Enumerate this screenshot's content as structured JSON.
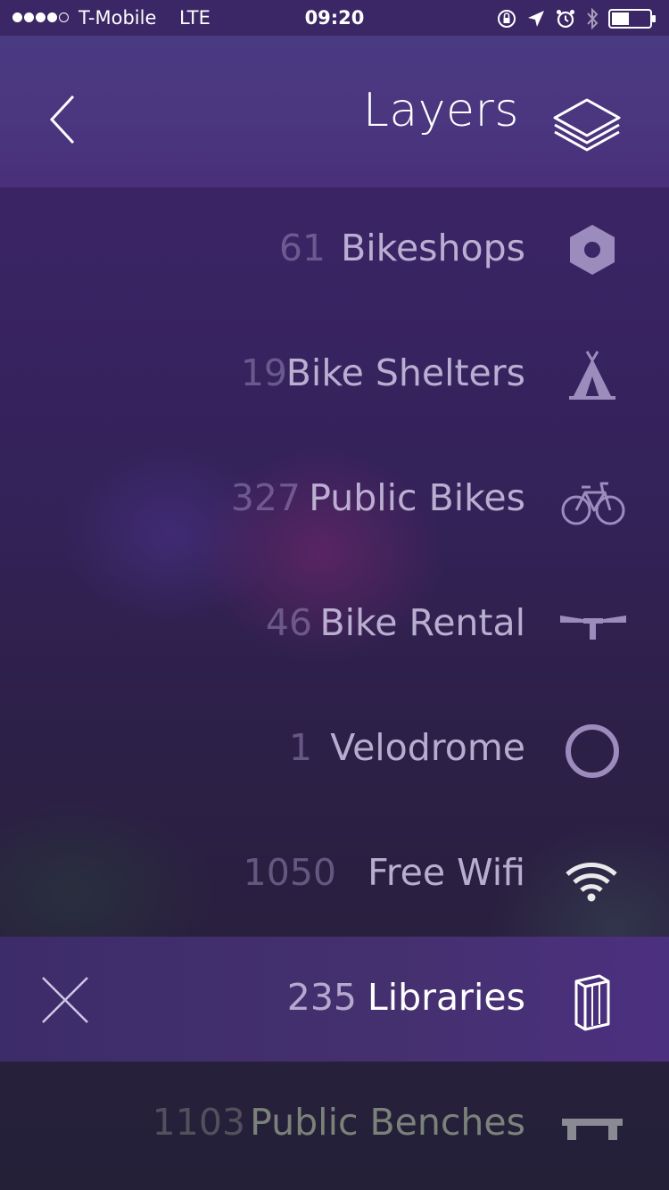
{
  "status_bar": {
    "carrier": "T-Mobile",
    "network": "LTE",
    "time": "09:20",
    "icons": [
      "signal-dots-icon",
      "orientation-lock-icon",
      "location-arrow-icon",
      "alarm-icon",
      "bluetooth-icon",
      "battery-icon"
    ]
  },
  "header": {
    "title": "Layers",
    "back_icon": "chevron-left-icon",
    "layers_icon": "layers-stack-icon"
  },
  "layers": [
    {
      "count": "61",
      "label": "Bikeshops",
      "icon": "hex-nut-icon"
    },
    {
      "count": "19",
      "label": "Bike Shelters",
      "icon": "tent-icon"
    },
    {
      "count": "327",
      "label": "Public Bikes",
      "icon": "bicycle-icon"
    },
    {
      "count": "46",
      "label": "Bike Rental",
      "icon": "handlebar-icon"
    },
    {
      "count": "1",
      "label": "Velodrome",
      "icon": "ring-icon"
    },
    {
      "count": "1050",
      "label": "Free Wifi",
      "icon": "wifi-icon"
    },
    {
      "count": "235",
      "label": "Libraries",
      "icon": "books-icon",
      "selected": true,
      "close_icon": "close-icon"
    },
    {
      "count": "1103",
      "label": "Public Benches",
      "icon": "bench-icon"
    }
  ],
  "colors": {
    "header_bg": "#4a3a82",
    "list_bg": "#3b2666",
    "selected_row_bg": "#45306f",
    "icon_lavender": "#9c8cbe",
    "text_white": "#ffffff"
  }
}
